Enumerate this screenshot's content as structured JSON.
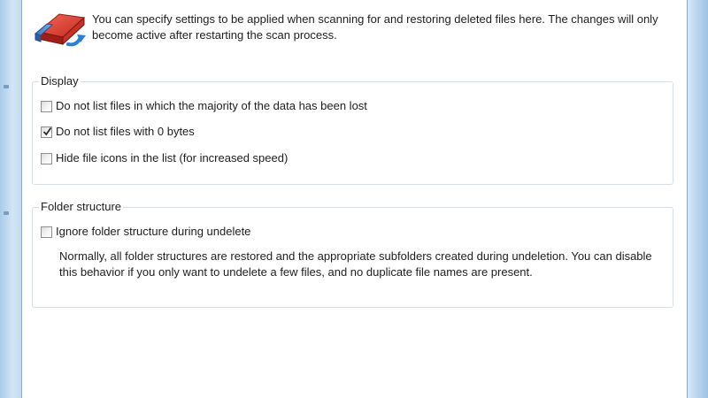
{
  "header": {
    "description": "You can specify settings to be applied when scanning for and restoring deleted files here. The changes will only become active after restarting the scan process."
  },
  "display_group": {
    "legend": "Display",
    "options": [
      {
        "label": "Do not list files in which the majority of the data has been lost",
        "checked": false
      },
      {
        "label": "Do not list files with 0 bytes",
        "checked": true
      },
      {
        "label": "Hide file icons in the list (for increased speed)",
        "checked": false
      }
    ]
  },
  "folder_group": {
    "legend": "Folder structure",
    "option": {
      "label": "Ignore folder structure during undelete",
      "checked": false
    },
    "description": "Normally, all folder structures are restored and the appropriate subfolders created during undeletion. You can disable this behavior if you only want to undelete a few files, and no duplicate file names are present."
  },
  "icons": {
    "header": "eraser-restore-icon",
    "checkmark": "checkmark-icon"
  }
}
